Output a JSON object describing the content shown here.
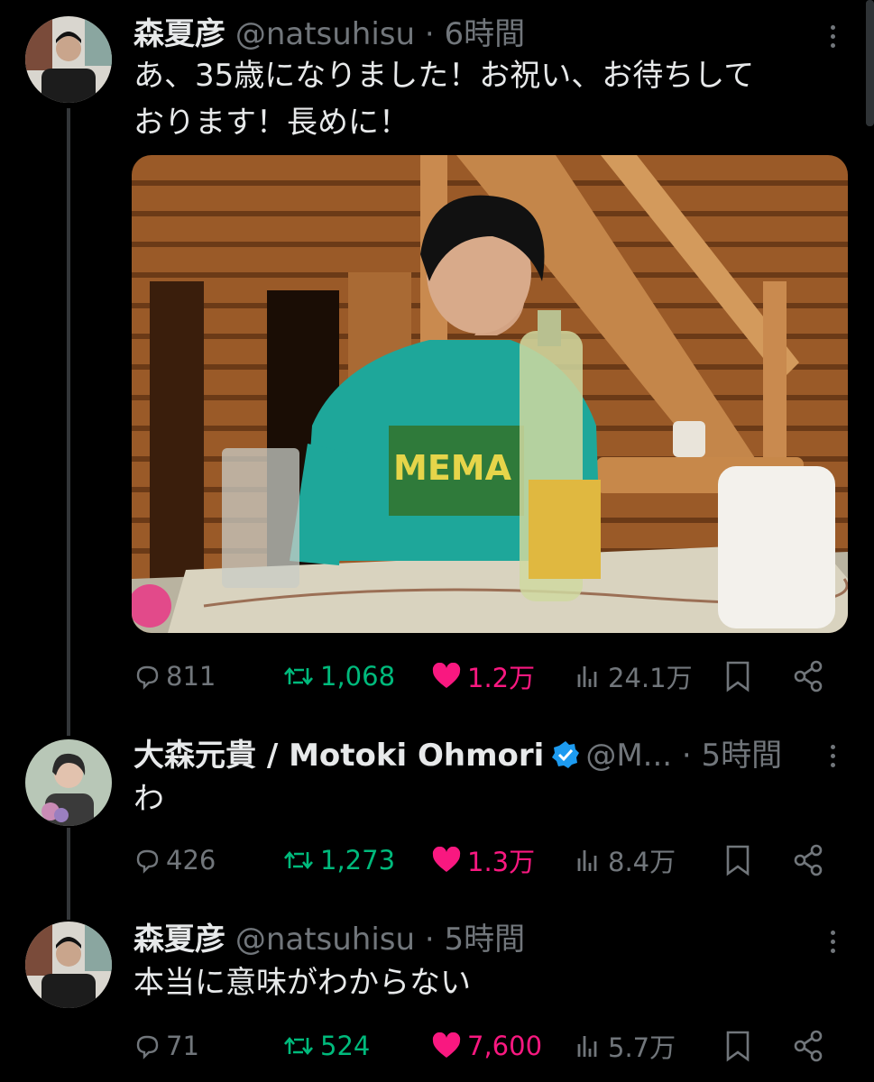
{
  "colors": {
    "background": "#000000",
    "text": "#e7e9ea",
    "muted": "#71767b",
    "retweet": "#00ba7c",
    "like": "#f91880",
    "verified": "#1d9bf0"
  },
  "tweets": [
    {
      "name": "森夏彦",
      "handle": "@natsuhisu",
      "time": "6時間",
      "text_lines": [
        "あ、35歳になりました！お祝い、お待ちして",
        "おります！長めに！"
      ],
      "media": "photo-man-teal-shirt-log-cabin",
      "replies": "811",
      "retweets": "1,068",
      "likes": "1.2万",
      "views": "24.1万"
    },
    {
      "name": "大森元貴 / Motoki Ohmori",
      "verified": true,
      "handle": "@M...",
      "time": "5時間",
      "text_lines": [
        "わ"
      ],
      "replies": "426",
      "retweets": "1,273",
      "likes": "1.3万",
      "views": "8.4万"
    },
    {
      "name": "森夏彦",
      "handle": "@natsuhisu",
      "time": "5時間",
      "text_lines": [
        "本当に意味がわからない"
      ],
      "replies": "71",
      "retweets": "524",
      "likes": "7,600",
      "views": "5.7万"
    }
  ],
  "icons": {
    "reply": "speech-bubble-icon",
    "retweet": "retweet-arrows-icon",
    "like": "heart-filled-icon",
    "views": "bar-chart-icon",
    "bookmark": "bookmark-icon",
    "share": "share-icon",
    "more": "vertical-dots-icon"
  }
}
